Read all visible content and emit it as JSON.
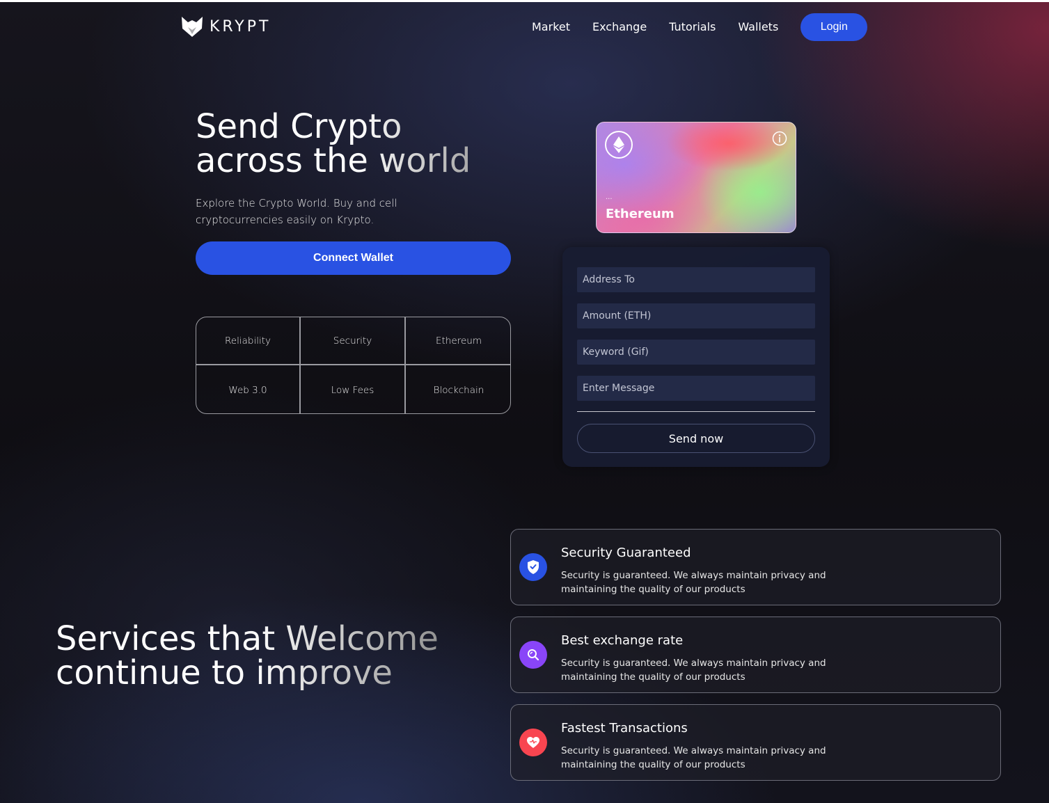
{
  "brand": {
    "name": "KRYPT"
  },
  "nav": {
    "items": [
      "Market",
      "Exchange",
      "Tutorials",
      "Wallets"
    ],
    "login_label": "Login"
  },
  "hero": {
    "title_line1": "Send Crypto",
    "title_line2": "across the world",
    "subtitle": "Explore the Crypto World. Buy and cell cryptocurrencies easily on Krypto.",
    "connect_label": "Connect Wallet",
    "features": [
      "Reliability",
      "Security",
      "Ethereum",
      "Web 3.0",
      "Low Fees",
      "Blockchain"
    ]
  },
  "eth_card": {
    "address": "...",
    "name": "Ethereum",
    "icon": "ethereum-icon"
  },
  "send_form": {
    "address_placeholder": "Address To",
    "amount_placeholder": "Amount (ETH)",
    "keyword_placeholder": "Keyword (Gif)",
    "message_placeholder": "Enter Message",
    "send_label": "Send now"
  },
  "services": {
    "title_line1": "Services that Welcome",
    "title_line2": "continue to improve",
    "cards": [
      {
        "title": "Security Guaranteed",
        "description": "Security is guaranteed. We always maintain privacy and maintaining the quality of our products",
        "icon": "shield-check-icon",
        "color": "#2952e3"
      },
      {
        "title": "Best exchange rate",
        "description": "Security is guaranteed. We always maintain privacy and maintaining the quality of our products",
        "icon": "search-icon",
        "color": "#8945f8"
      },
      {
        "title": "Fastest Transactions",
        "description": "Security is guaranteed. We always maintain privacy and maintaining the quality of our products",
        "icon": "heart-icon",
        "color": "#f84550"
      }
    ]
  },
  "colors": {
    "accent": "#2952e3",
    "purple": "#8945f8",
    "red": "#f84550"
  }
}
